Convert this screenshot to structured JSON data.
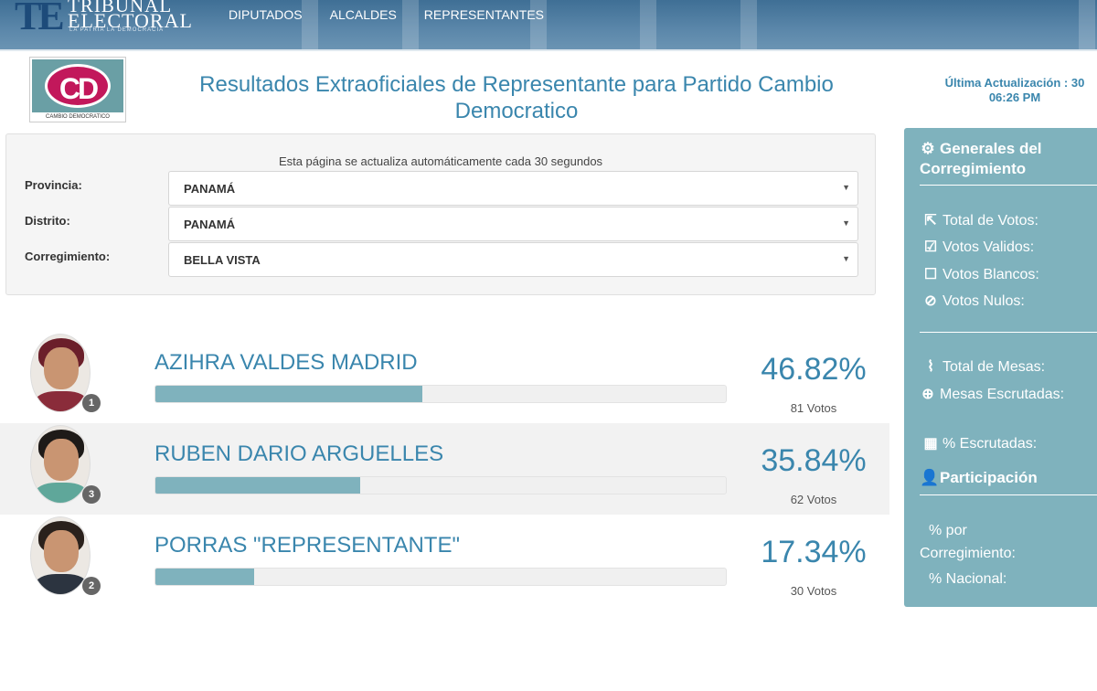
{
  "header": {
    "logo": {
      "mark": "TE",
      "line1": "TRIBUNAL",
      "line2": "ELECTORAL",
      "tagline": "LA PATRIA LA DEMOCRACIA"
    },
    "nav": [
      "DIPUTADOS",
      "ALCALDES",
      "REPRESENTANTES"
    ]
  },
  "party": {
    "logo_text": "CD",
    "logo_subtext": "CAMBIO DEMOCRATICO"
  },
  "page_title": "Resultados Extraoficiales de Representante para Partido Cambio Democratico",
  "last_update": {
    "line1": "Última Actualización : 30",
    "line2": "06:26 PM"
  },
  "filters": {
    "note": "Esta página se actualiza automáticamente cada 30 segundos",
    "provincia": {
      "label": "Provincia:",
      "value": "PANAMÁ"
    },
    "distrito": {
      "label": "Distrito:",
      "value": "PANAMÁ"
    },
    "corregimiento": {
      "label": "Corregimiento:",
      "value": "BELLA VISTA"
    }
  },
  "candidates": [
    {
      "name": "AZIHRA VALDES MADRID",
      "number": "1",
      "percent": "46.82%",
      "share": 0.4682,
      "votes": "81 Votos"
    },
    {
      "name": "RUBEN DARIO ARGUELLES",
      "number": "3",
      "percent": "35.84%",
      "share": 0.3584,
      "votes": "62 Votos"
    },
    {
      "name": "PORRAS \"REPRESENTANTE\"",
      "number": "2",
      "percent": "17.34%",
      "share": 0.1734,
      "votes": "30 Votos"
    }
  ],
  "sidebar": {
    "generales_title": "Generales del Corregimiento",
    "total_votos": "Total de Votos:",
    "votos_validos": "Votos Validos:",
    "votos_blancos": "Votos Blancos:",
    "votos_nulos": "Votos Nulos:",
    "total_mesas": "Total de Mesas:",
    "mesas_escrutadas": "Mesas Escrutadas:",
    "pct_escrutadas": "% Escrutadas:",
    "participacion_title": "Participación",
    "pct_corregimiento": "% por Corregimiento:",
    "pct_nacional": "% Nacional:"
  },
  "colors": {
    "accent": "#3a86ad",
    "bar": "#7fb2bd",
    "sidebar": "#7fb2bd",
    "party": "#c2185b"
  },
  "icons": [
    "gear-icon",
    "share-icon",
    "check-square-icon",
    "square-icon",
    "ban-icon",
    "paperclip-icon",
    "search-plus-icon",
    "grid-icon",
    "user-icon",
    "chevron-down-icon"
  ]
}
